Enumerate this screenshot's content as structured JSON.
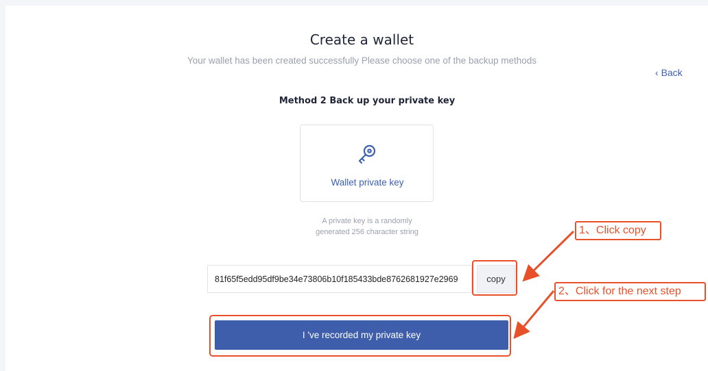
{
  "header": {
    "title": "Create a wallet",
    "subtitle": "Your wallet has been created successfully Please choose one of the backup methods",
    "back_label": "Back"
  },
  "method": {
    "title": "Method 2 Back up your private key"
  },
  "key_card": {
    "icon": "key-icon",
    "label": "Wallet private key"
  },
  "hint": {
    "line1": "A private key is a randomly",
    "line2": "generated 256 character string"
  },
  "private_key": {
    "value": "81f65f5edd95df9be34e73806b10f185433bde8762681927e2969",
    "copy_label": "copy"
  },
  "primary_button": {
    "label": "I 've recorded my private key"
  },
  "annotations": {
    "step1": "1、Click copy",
    "step2": "2、Click for the next step"
  },
  "colors": {
    "accent": "#3e5daa",
    "link": "#3c5fae",
    "annotation": "#e8502a"
  }
}
